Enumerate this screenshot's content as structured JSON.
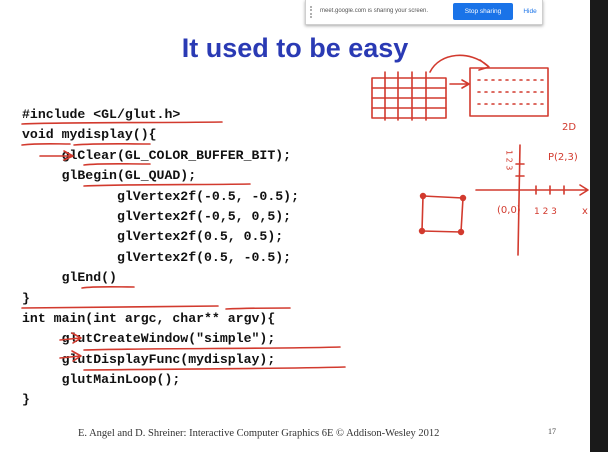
{
  "screen_share": {
    "message": "meet.google.com is sharing your screen.",
    "stop_label": "Stop sharing",
    "hide_label": "Hide"
  },
  "slide": {
    "title": "It used to be easy",
    "code_lines": [
      "#include <GL/glut.h>",
      "void mydisplay(){",
      "     glClear(GL_COLOR_BUFFER_BIT);",
      "     glBegin(GL_QUAD);",
      "            glVertex2f(-0.5, -0.5);",
      "            glVertex2f(-0,5, 0,5);",
      "            glVertex2f(0.5, 0.5);",
      "            glVertex2f(0.5, -0.5);",
      "     glEnd()",
      "}",
      "int main(int argc, char** argv){",
      "     glutCreateWindow(\"simple\");",
      "     glutDisplayFunc(mydisplay);",
      "     glutMainLoop();",
      "}"
    ],
    "footer": "E. Angel and D. Shreiner: Interactive Computer Graphics 6E © Addison-Wesley 2012",
    "page_number": "17"
  },
  "annotations": {
    "ink_color": "#d23a2e",
    "label_2d": "2D",
    "label_point": "P(2,3)",
    "label_origin": "(0,0)",
    "axis_ticks_x": "1 2 3",
    "axis_ticks_y": "1 2 3",
    "axis_x_label": "x"
  }
}
